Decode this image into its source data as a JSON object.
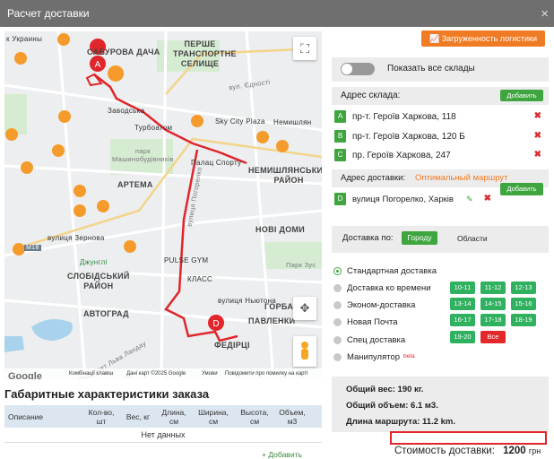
{
  "window": {
    "title": "Расчет доставки",
    "close_icon": "×"
  },
  "map": {
    "labels": {
      "ukraine_st": "к Украины",
      "saburova": "САБУРОВА ДАЧА",
      "pershe": "ПЕРШЕ\nТРАНСПОРТНЕ\nСЕЛИЩЕ",
      "zavodska": "Заводська",
      "turbo": "Турбоатом",
      "sky": "Sky City Plaza",
      "nemysh_st": "Немишлян",
      "palats": "Палац Спорту",
      "park": "парк\nМашинобудівників",
      "artema": "АРТЕМА",
      "nemysh": "НЕМИШЛЯНСЬКИЙ\nРАЙОН",
      "zernova": "вулиця Зернова",
      "novi": "НОВІ ДОМИ",
      "dzhungli": "Джунглі",
      "pulse": "PULSE GYM",
      "park2": "Парк Зус",
      "slobid": "СЛОБІДСЬКИЙ\nРАЙОН",
      "klass": "КЛАСС",
      "nyutona": "вулиця Ньютона",
      "avtograd": "АВТОГРАД",
      "gorban": "ГОРБАН",
      "pavlenky": "ПАВЛЕНКИ",
      "fedirtsi": "ФЕДІРЦІ",
      "landau": "Проспект Льва Ландау",
      "edn": "вул. Єдності",
      "pogorelko": "вулиця Погорелко",
      "m18": "M18"
    },
    "markers": [
      "A",
      "D"
    ],
    "attribution": {
      "google": "Google",
      "keys": "Комбінації клавіш",
      "data": "Дані карт ©2025 Google",
      "terms": "Умови",
      "report": "Повідомити про помилку на карті"
    }
  },
  "dims": {
    "title": "Габаритные характеристики заказа",
    "columns": [
      "Описание",
      "Кол-во, шт",
      "Вес, кг",
      "Длина, см",
      "Ширина, см",
      "Высота, см",
      "Объем, м3"
    ],
    "empty": "Нет данных",
    "add": "+ Добавить"
  },
  "right": {
    "logistics_button": "Загруженность логистики",
    "show_all": "Показать все склады",
    "warehouse_title": "Адрес склада:",
    "add_button": "Добавить",
    "warehouses": [
      {
        "letter": "A",
        "address": "пр-т. Героїв Харкова, 118"
      },
      {
        "letter": "B",
        "address": "пр-т. Героїв Харкова, 120 Б"
      },
      {
        "letter": "C",
        "address": "пр. Героїв Харкова, 247"
      }
    ],
    "delivery_title": "Адрес доставки:",
    "optimal": "Оптимальный маршрут",
    "delivery": {
      "letter": "D",
      "address": "вулиця Погорелко, Харків"
    },
    "delivery_by": "Доставка по:",
    "city_tab": "Городу",
    "region_tab": "Области",
    "options": [
      {
        "label": "Стандартная доставка",
        "selected": true
      },
      {
        "label": "Доставка ко времени",
        "selected": false
      },
      {
        "label": "Эконом-доставка",
        "selected": false
      },
      {
        "label": "Новая Почта",
        "selected": false
      },
      {
        "label": "Спец доставка",
        "selected": false
      },
      {
        "label": "Манипулятор",
        "selected": false
      }
    ],
    "beta": "beta",
    "slots": [
      "10-11",
      "11-12",
      "12-13",
      "13-14",
      "14-15",
      "15-16",
      "16-17",
      "17-18",
      "18-19",
      "19-20",
      "Все"
    ],
    "totals": {
      "weight": "Общий вес: 190 кг.",
      "volume": "Общий объем: 6.1 м3.",
      "route": "Длина маршрута: 11.2 km."
    },
    "cost_label": "Стоимость доставки:",
    "cost_value": "1200",
    "cost_unit": "грн"
  },
  "colors": {
    "accent_green": "#3fa53f",
    "orange": "#f07b25",
    "route_red": "#e0262a"
  }
}
